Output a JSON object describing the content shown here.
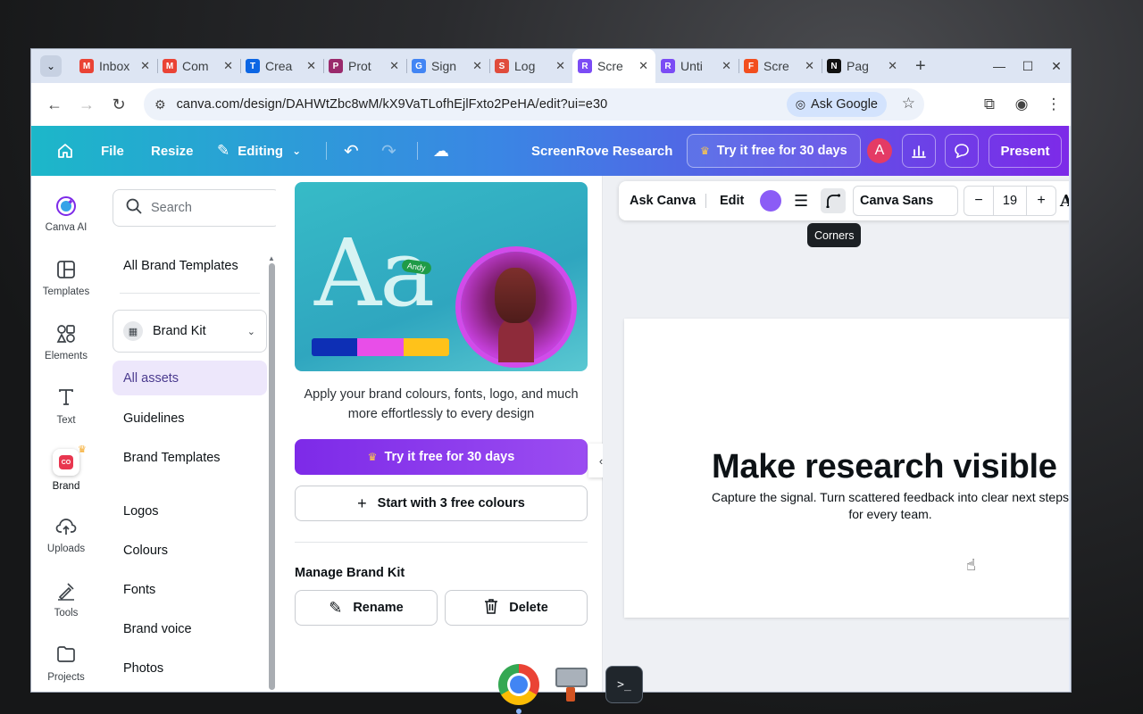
{
  "browser": {
    "tabs": [
      {
        "title": "Inbox",
        "favicon": "M",
        "favicon_color": "#ea4335",
        "active": false
      },
      {
        "title": "Com",
        "favicon": "M",
        "favicon_color": "#ea4335",
        "active": false
      },
      {
        "title": "Crea",
        "favicon": "T",
        "favicon_color": "#0c66e4",
        "active": false
      },
      {
        "title": "Prot",
        "favicon": "P",
        "favicon_color": "#9a2a6c",
        "active": false
      },
      {
        "title": "Sign",
        "favicon": "G",
        "favicon_color": "#4285f4",
        "active": false
      },
      {
        "title": "Log",
        "favicon": "S",
        "favicon_color": "#e04c3c",
        "active": false
      },
      {
        "title": "Scre",
        "favicon": "R",
        "favicon_color": "#7b4cf5",
        "active": true
      },
      {
        "title": "Unti",
        "favicon": "R",
        "favicon_color": "#7b4cf5",
        "active": false
      },
      {
        "title": "Scre",
        "favicon": "F",
        "favicon_color": "#f24e1e",
        "active": false
      },
      {
        "title": "Pag",
        "favicon": "N",
        "favicon_color": "#111111",
        "active": false
      }
    ],
    "url": "canva.com/design/DAHWtZbc8wM/kX9VaTLofhEjlFxto2PeHA/edit?ui=e30",
    "ask_google_label": "Ask Google"
  },
  "header": {
    "file_label": "File",
    "resize_label": "Resize",
    "editing_label": "Editing",
    "design_title": "ScreenRove Research",
    "try_free_label": "Try it free for 30 days",
    "avatar_initial": "A",
    "present_label": "Present"
  },
  "rail": {
    "items": [
      {
        "label": "Canva AI",
        "icon": "canva-ai-icon"
      },
      {
        "label": "Templates",
        "icon": "templates-icon"
      },
      {
        "label": "Elements",
        "icon": "elements-icon"
      },
      {
        "label": "Text",
        "icon": "text-icon"
      },
      {
        "label": "Brand",
        "icon": "brand-icon"
      },
      {
        "label": "Uploads",
        "icon": "uploads-icon"
      },
      {
        "label": "Tools",
        "icon": "tools-icon"
      },
      {
        "label": "Projects",
        "icon": "projects-icon"
      }
    ],
    "brand_logo_text": "CO"
  },
  "side_panel": {
    "search_placeholder": "Search",
    "all_brand_templates": "All Brand Templates",
    "brand_kit_label": "Brand Kit",
    "items": [
      "All assets",
      "Guidelines",
      "Brand Templates",
      "Logos",
      "Colours",
      "Fonts",
      "Brand voice",
      "Photos"
    ]
  },
  "brand_panel": {
    "hero_text": "Aa",
    "hero_tag": "Andy",
    "hero_colors": [
      "#0d2fb5",
      "#e84ee8",
      "#ffc21a"
    ],
    "description": "Apply your brand colours, fonts, logo, and much more effortlessly to every design",
    "try_free_label": "Try it free for 30 days",
    "start_colours_label": "Start with 3 free colours",
    "manage_title": "Manage Brand Kit",
    "rename_label": "Rename",
    "delete_label": "Delete"
  },
  "context_toolbar": {
    "ask_canva_label": "Ask Canva",
    "edit_label": "Edit",
    "text_color": "#8b5cf6",
    "font_name": "Canva Sans",
    "font_size": "19",
    "tooltip": "Corners"
  },
  "canvas": {
    "headline": "Make research visible",
    "subtext": "Capture the signal. Turn scattered feedback into clear next steps for every team."
  }
}
